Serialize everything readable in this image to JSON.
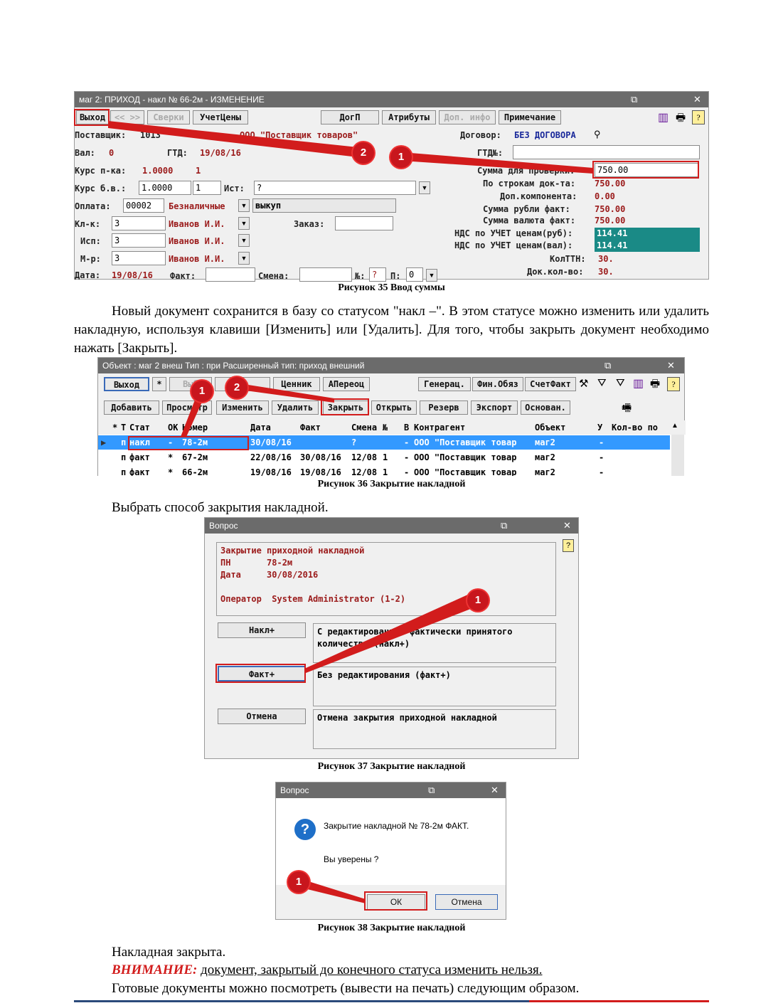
{
  "fig35": {
    "title": "маг   2:  ПРИХОД - накл № 66-2м    - ИЗМЕНЕНИЕ",
    "toolbar": {
      "exit": "Выход",
      "nav": "<< >>",
      "sverki": "Сверки",
      "uchetceny": "УчетЦены",
      "dogp": "ДогП",
      "attributes": "Атрибуты",
      "dop_info": "Доп. инфо",
      "note": "Примечание"
    },
    "supplier_label": "Поставщик:",
    "supplier_code": "1013",
    "supplier_name": "ООО \"Поставщик товаров\"",
    "contract_label": "Договор:",
    "contract_value": "БЕЗ ДОГОВОРА",
    "val_label": "Вал:",
    "val_value": "0",
    "gtd_label": "ГТД:",
    "gtd_value": "19/08/16",
    "gtdn_label": "ГТД№:",
    "kurs_pk_label": "Курс п-ка:",
    "kurs_pk_value": "1.0000",
    "kurs_pk_num": "1",
    "check_sum_label": "Сумма для проверки:",
    "check_sum_value": "750.00",
    "kurs_bv_label": "Курс б.в.:",
    "kurs_bv_value": "1.0000",
    "kurs_bv_num": "1",
    "ist_label": "Ист:",
    "ist_value": "?",
    "rows_sum_label": "По строкам док-та:",
    "rows_sum_value": "750.00",
    "dop_comp_label": "Доп.компонента:",
    "dop_comp_value": "0.00",
    "pay_label": "Оплата:",
    "pay_code": "00002",
    "pay_type": "Безналичные",
    "pay_kind": "выкуп",
    "sum_rub_label": "Сумма рубли факт:",
    "sum_rub_value": "750.00",
    "sum_val_label": "Сумма валюта факт:",
    "sum_val_value": "750.00",
    "kk_label": "Кл-к:",
    "kk_value": "3",
    "kk_name": "Иванов И.И.",
    "order_label": "Заказ:",
    "nds_rub_label": "НДС по УЧЕТ ценам(руб):",
    "nds_rub_value": "114.41",
    "isp_label": "Исп:",
    "isp_value": "3",
    "isp_name": "Иванов И.И.",
    "nds_val_label": "НДС по УЧЕТ ценам(вал):",
    "nds_val_value": "114.41",
    "mr_label": "М-р:",
    "mr_value": "3",
    "mr_name": "Иванов И.И.",
    "kolttn_label": "КолТТН:",
    "kolttn_value": "30.",
    "date_label": "Дата:",
    "date_value": "19/08/16",
    "fact_label": "Факт:",
    "smena_label": "Смена:",
    "num_label": "№:",
    "num_value": "?",
    "p_label": "П:",
    "p_value": "0",
    "dok_kol_label": "Док.кол-во:",
    "dok_kol_value": "30.",
    "badges": [
      "2",
      "1"
    ],
    "caption": "Рисунок 35 Ввод суммы"
  },
  "para1": "Новый документ сохранится в базу со статусом \"накл –\". В этом статусе можно изменить или удалить накладную, используя клавиши [Изменить] или [Удалить]. Для того, чтобы закрыть документ необходимо нажать [Закрыть].",
  "fig36": {
    "title": "Объект : маг 2  внеш  Тип : при Расширенный тип: приход внешний",
    "row1": {
      "exit": "Выход",
      "star": "*",
      "vyb": "Выб",
      "ty": "ты",
      "cennik": "Ценник",
      "apereoc": "АПереоц",
      "generac": "Генерац.",
      "fin": "Фин.Обяз",
      "schetfakt": "СчетФакт"
    },
    "row2": {
      "add": "Добавить",
      "view": "Просмотр",
      "edit": "Изменить",
      "delete": "Удалить",
      "close": "Закрыть",
      "open": "Открыть",
      "reserve": "Резерв",
      "export": "Экспорт",
      "osnovan": "Основан."
    },
    "headers": [
      "*",
      "Т",
      "Стат",
      "ОК",
      "Номер",
      "Дата",
      "Факт",
      "Смена",
      "№",
      "В",
      "Контрагент",
      "Объект",
      "У",
      "Кол-во по"
    ],
    "rows": [
      [
        "п",
        "накл",
        "-",
        "78-2м",
        "30/08/16",
        "",
        "?",
        "",
        "-",
        "ООО \"Поставщик товар",
        "маг2",
        "-"
      ],
      [
        "п",
        "факт",
        "*",
        "67-2м",
        "22/08/16",
        "30/08/16",
        "12/08",
        "1",
        "-",
        "ООО \"Поставщик товар",
        "маг2",
        "-"
      ],
      [
        "п",
        "факт",
        "*",
        "66-2м",
        "19/08/16",
        "19/08/16",
        "12/08",
        "1",
        "-",
        "ООО \"Поставщик товар",
        "маг2",
        "-"
      ]
    ],
    "badges": [
      "1",
      "2"
    ],
    "caption": "Рисунок 36 Закрытие накладной"
  },
  "para2": "Выбрать способ закрытия накладной.",
  "fig37": {
    "title": "Вопрос",
    "info": "Закрытие приходной накладной\nПН       78-2м\nДата     30/08/2016\n\nОператор  System Administrator (1-2)",
    "btn1": "Накл+",
    "desc1": "С редактированием фактически принятого\nколичества (накл+)",
    "btn2": "Факт+",
    "desc2": "Без редактирования (факт+)",
    "btn3": "Отмена",
    "desc3": "Отмена закрытия приходной накладной",
    "badge": "1",
    "caption": "Рисунок 37 Закрытие накладной"
  },
  "fig38": {
    "title": "Вопрос",
    "msg": "Закрытие накладной №  78-2м ФАКТ.",
    "sure": "Вы уверены ?",
    "ok": "ОК",
    "cancel": "Отмена",
    "badge": "1",
    "caption": "Рисунок 38 Закрытие накладной"
  },
  "para3": "Накладная закрыта.",
  "warn_label": "ВНИМАНИЕ:",
  "warn_text": "документ, закрытый до конечного статуса изменить нельзя.",
  "para4": "Готовые документы можно посмотреть (вывести на печать) следующим образом."
}
